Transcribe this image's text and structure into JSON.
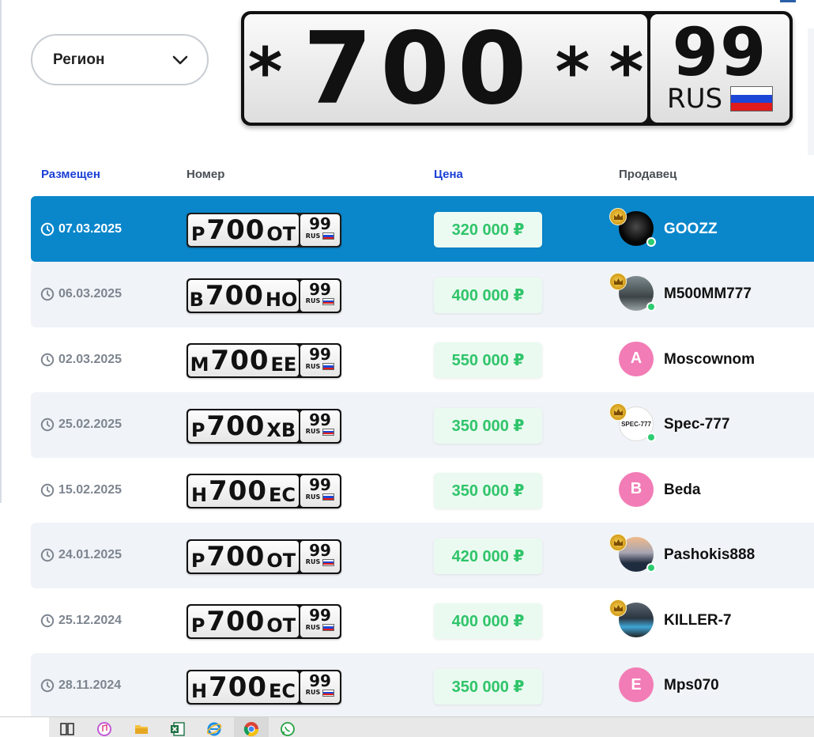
{
  "region_select": {
    "label": "Регион"
  },
  "big_plate": {
    "left_star": "*",
    "digits": "700",
    "star_a": "*",
    "star_b": "*",
    "region": "99",
    "country": "RUS"
  },
  "table": {
    "headers": {
      "posted": "Размещен",
      "number": "Номер",
      "price": "Цена",
      "seller": "Продавец"
    },
    "rows": [
      {
        "date": "07.03.2025",
        "l1": "Р",
        "digits": "700",
        "l2": "ОТ",
        "region": "99",
        "country": "RUS",
        "price": "320 000 ₽",
        "seller": "GOOZZ",
        "avatar": "img-dark",
        "avatar_text": "",
        "crown": true,
        "online": true,
        "active": true
      },
      {
        "date": "06.03.2025",
        "l1": "В",
        "digits": "700",
        "l2": "НО",
        "region": "99",
        "country": "RUS",
        "price": "400 000 ₽",
        "seller": "M500MM777",
        "avatar": "img-car1",
        "avatar_text": "",
        "crown": true,
        "online": true,
        "active": false
      },
      {
        "date": "02.03.2025",
        "l1": "М",
        "digits": "700",
        "l2": "ЕЕ",
        "region": "99",
        "country": "RUS",
        "price": "550 000 ₽",
        "seller": "Moscownom",
        "avatar": "letter",
        "avatar_text": "A",
        "crown": false,
        "online": false,
        "active": false
      },
      {
        "date": "25.02.2025",
        "l1": "Р",
        "digits": "700",
        "l2": "ХВ",
        "region": "99",
        "country": "RUS",
        "price": "350 000 ₽",
        "seller": "Spec-777",
        "avatar": "img-spec",
        "avatar_text": "SPEC-777",
        "crown": true,
        "online": true,
        "active": false
      },
      {
        "date": "15.02.2025",
        "l1": "Н",
        "digits": "700",
        "l2": "ЕС",
        "region": "99",
        "country": "RUS",
        "price": "350 000 ₽",
        "seller": "Beda",
        "avatar": "letter",
        "avatar_text": "B",
        "crown": false,
        "online": false,
        "active": false
      },
      {
        "date": "24.01.2025",
        "l1": "Р",
        "digits": "700",
        "l2": "ОТ",
        "region": "99",
        "country": "RUS",
        "price": "420 000 ₽",
        "seller": "Pashokis888",
        "avatar": "img-sunset",
        "avatar_text": "",
        "crown": true,
        "online": true,
        "active": false
      },
      {
        "date": "25.12.2024",
        "l1": "Р",
        "digits": "700",
        "l2": "ОТ",
        "region": "99",
        "country": "RUS",
        "price": "400 000 ₽",
        "seller": "KILLER-7",
        "avatar": "img-car2",
        "avatar_text": "",
        "crown": true,
        "online": false,
        "active": false
      },
      {
        "date": "28.11.2024",
        "l1": "Н",
        "digits": "700",
        "l2": "ЕС",
        "region": "99",
        "country": "RUS",
        "price": "350 000 ₽",
        "seller": "Mps070",
        "avatar": "letter",
        "avatar_text": "E",
        "crown": false,
        "online": false,
        "active": false
      }
    ]
  },
  "taskbar": {
    "icons": [
      "task-view-icon",
      "itunes-icon",
      "file-explorer-icon",
      "excel-icon",
      "internet-explorer-icon",
      "chrome-icon",
      "whatsapp-icon"
    ]
  },
  "colors": {
    "active_row": "#0a87cb",
    "alt_row": "#f0f3f7",
    "price_text": "#2fc46a",
    "header_blue": "#1a3fd6"
  }
}
